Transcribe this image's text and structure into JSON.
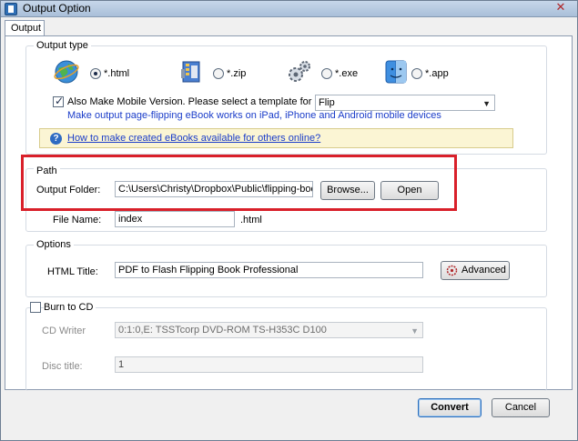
{
  "window": {
    "title": "Output Option",
    "close_label": "✕"
  },
  "tab": {
    "label": "Output"
  },
  "output_type": {
    "group_label": "Output type",
    "options": [
      {
        "label": "*.html",
        "icon": "globe-icon",
        "checked": true
      },
      {
        "label": "*.zip",
        "icon": "zip-archive-icon",
        "checked": false
      },
      {
        "label": "*.exe",
        "icon": "gears-icon",
        "checked": false
      },
      {
        "label": "*.app",
        "icon": "mac-finder-icon",
        "checked": false
      }
    ],
    "mobile_checkbox_label": "Also Make Mobile Version. Please select a template for mobile:",
    "mobile_checked": true,
    "mobile_template": "Flip",
    "mobile_note": "Make output page-flipping eBook works on iPad, iPhone and Android mobile devices",
    "help_link": "How to make created eBooks available for others online?"
  },
  "path": {
    "group_label": "Path",
    "folder_label": "Output Folder:",
    "folder_value": "C:\\Users\\Christy\\Dropbox\\Public\\flipping-book",
    "browse_label": "Browse...",
    "open_label": "Open",
    "filename_label": "File Name:",
    "filename_value": "index",
    "extension": ".html"
  },
  "options": {
    "group_label": "Options",
    "html_title_label": "HTML Title:",
    "html_title_value": "PDF to Flash Flipping Book Professional",
    "advanced_label": "Advanced"
  },
  "burn": {
    "checkbox_label": "Burn to CD",
    "checked": false,
    "cd_writer_label": "CD Writer",
    "cd_writer_value": "0:1:0,E: TSSTcorp DVD-ROM TS-H353C D100",
    "disc_title_label": "Disc title:",
    "disc_title_value": "1"
  },
  "footer": {
    "convert_label": "Convert",
    "cancel_label": "Cancel"
  },
  "colors": {
    "highlight_red": "#d9202a",
    "link_blue": "#1a3cc9"
  }
}
